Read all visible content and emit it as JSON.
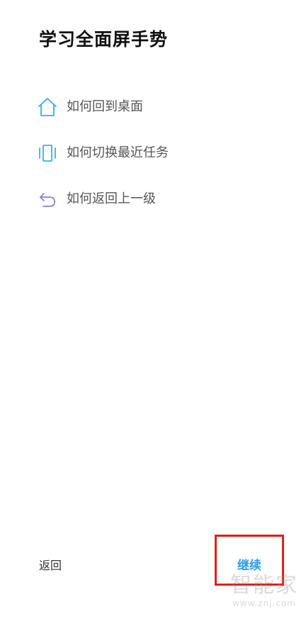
{
  "page": {
    "title": "学习全面屏手势"
  },
  "gestures": [
    {
      "label": "如何回到桌面",
      "icon": "home-icon",
      "color": "#3ea8f2"
    },
    {
      "label": "如何切换最近任务",
      "icon": "recent-tasks-icon",
      "color": "#33b9d6"
    },
    {
      "label": "如何返回上一级",
      "icon": "back-arrow-icon",
      "color": "#8b7fd6"
    }
  ],
  "footer": {
    "back_label": "返回",
    "continue_label": "继续"
  },
  "colors": {
    "accent": "#2d9cf0",
    "highlight_box": "#e02020"
  },
  "watermark": {
    "text": "智能家",
    "url": "www.znj.com"
  }
}
